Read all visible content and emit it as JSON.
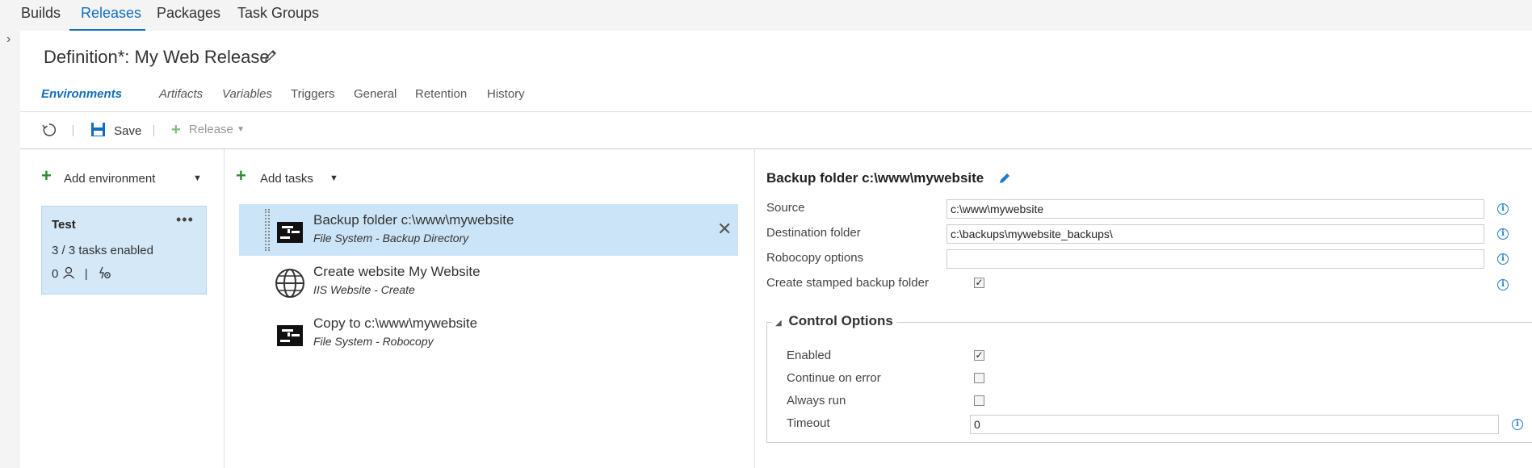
{
  "topnav": {
    "tabs": [
      "Builds",
      "Releases",
      "Packages",
      "Task Groups"
    ],
    "active": "Releases"
  },
  "definition": {
    "title": "Definition*: My Web Release",
    "subtabs": [
      "Environments",
      "Artifacts",
      "Variables",
      "Triggers",
      "General",
      "Retention",
      "History"
    ]
  },
  "toolbar": {
    "save_label": "Save",
    "release_label": "Release"
  },
  "environments": {
    "add_label": "Add environment",
    "card": {
      "name": "Test",
      "more": "•••",
      "tasks_enabled": "3 / 3 tasks enabled",
      "approvers_count": "0",
      "separator": "|"
    }
  },
  "tasks": {
    "add_label": "Add tasks",
    "items": [
      {
        "name": "Backup folder c:\\www\\mywebsite",
        "subtitle": "File System - Backup Directory",
        "icon": "filesystem-icon"
      },
      {
        "name": "Create website My Website",
        "subtitle": "IIS Website - Create",
        "icon": "globe-icon"
      },
      {
        "name": "Copy to c:\\www\\mywebsite",
        "subtitle": "File System - Robocopy",
        "icon": "filesystem-icon"
      }
    ]
  },
  "details": {
    "title": "Backup folder c:\\www\\mywebsite",
    "fields": {
      "source_label": "Source",
      "source_value": "c:\\www\\mywebsite",
      "dest_label": "Destination folder",
      "dest_value": "c:\\backups\\mywebsite_backups\\",
      "robocopy_label": "Robocopy options",
      "robocopy_value": "",
      "stamped_label": "Create stamped backup folder"
    },
    "control_options": {
      "title": "Control Options",
      "enabled_label": "Enabled",
      "continue_label": "Continue on error",
      "always_label": "Always run",
      "timeout_label": "Timeout",
      "timeout_value": "0"
    }
  },
  "colors": {
    "accent": "#106ebe",
    "selected_bg": "#cce4f7",
    "plus_green": "#2e8b2e"
  }
}
